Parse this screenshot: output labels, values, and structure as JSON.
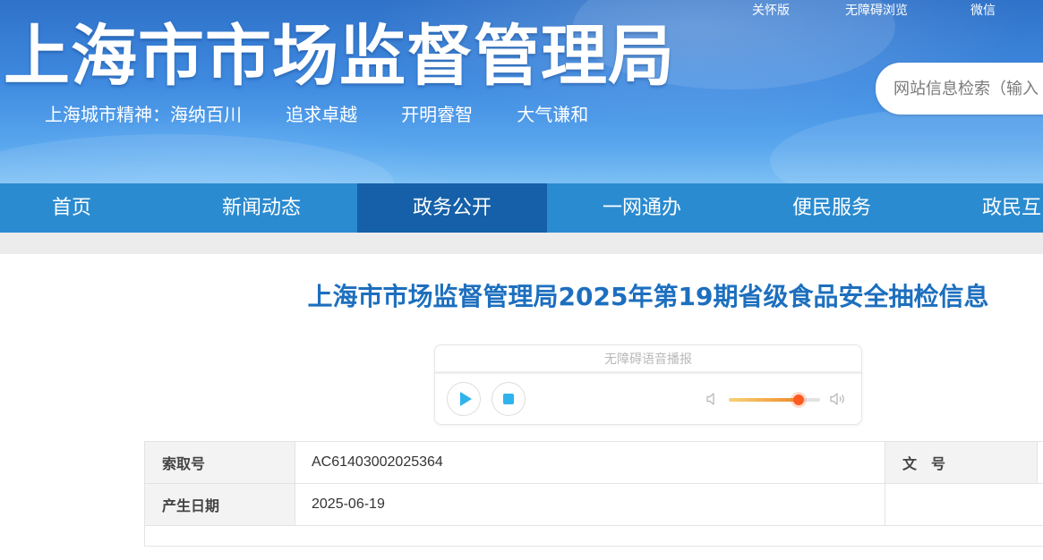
{
  "header": {
    "site_title": "上海市市场监督管理局",
    "slogan": "上海城市精神：海纳百川   追求卓越   开明睿智   大气谦和",
    "top_links": [
      "关怀版",
      "无障碍浏览",
      "微信"
    ],
    "search_placeholder": "网站信息检索（输入"
  },
  "nav": {
    "items": [
      "首页",
      "新闻动态",
      "政务公开",
      "一网通办",
      "便民服务",
      "政民互"
    ],
    "active": "政务公开"
  },
  "article": {
    "title": "上海市市场监督管理局2025年第19期省级食品安全抽检信息"
  },
  "player": {
    "label": "无障碍语音播报",
    "volume_fraction": 0.76,
    "icons": [
      "play-icon",
      "stop-icon",
      "volume-low-icon",
      "volume-high-icon"
    ],
    "accent_color": "#2fb3ec",
    "volume_color": "#ff5a1f"
  },
  "meta": {
    "rows": [
      {
        "label": "索取号",
        "value": "AC61403002025364",
        "label2": "文　号",
        "value2": ""
      },
      {
        "label": "产生日期",
        "value": "2025-06-19",
        "label2": "",
        "value2": ""
      }
    ]
  },
  "colors": {
    "nav_bg": "#2b8bd0",
    "nav_active": "#1560a8",
    "title_color": "#1d6fbe"
  }
}
